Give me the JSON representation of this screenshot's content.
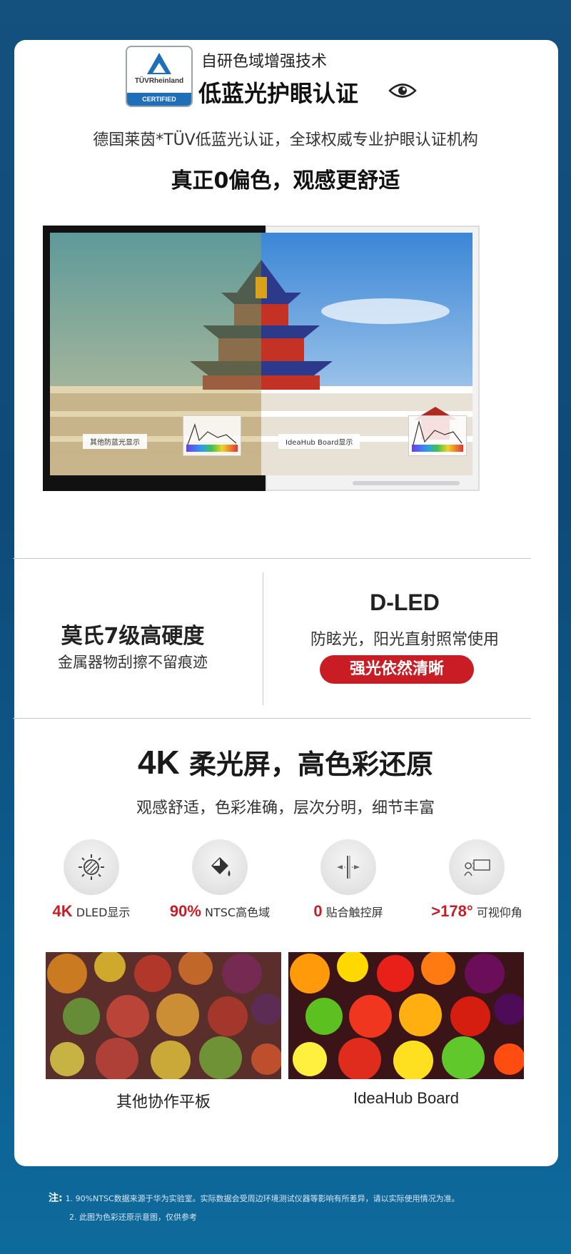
{
  "header": {
    "logo_brand": "TÜVRheinland",
    "logo_certified": "CERTIFIED",
    "subtitle": "自研色域增强技术",
    "title": "低蓝光护眼认证",
    "description": "德国莱茵*TÜV低蓝光认证，全球权威专业护眼认证机构",
    "headline": "真正0偏色，观感更舒适"
  },
  "comparison": {
    "left_label": "其他防蓝光显示",
    "right_label": "IdeaHub Board显示"
  },
  "hardness": {
    "title": "莫氏7级高硬度",
    "subtitle": "金属器物刮擦不留痕迹"
  },
  "dled": {
    "title": "D-LED",
    "subtitle": "防眩光，阳光直射照常使用",
    "badge": "强光依然清晰"
  },
  "display": {
    "title_k": "4K",
    "title_rest": " 柔光屏，高色彩还原",
    "subtitle": "观感舒适，色彩准确，层次分明，细节丰富"
  },
  "features": [
    {
      "value": "4K",
      "label": "DLED显示",
      "icon": "sun-icon"
    },
    {
      "value": "90%",
      "label": "NTSC高色域",
      "icon": "paint-bucket-icon"
    },
    {
      "value": "0",
      "label": "贴合触控屏",
      "icon": "touch-layer-icon"
    },
    {
      "value": ">178°",
      "label": "可视仰角",
      "icon": "viewing-angle-icon"
    }
  ],
  "fruit_compare": {
    "left_caption": "其他协作平板",
    "right_caption": "IdeaHub Board"
  },
  "notes": {
    "prefix": "注:",
    "note1": "1. 90%NTSC数据来源于华为实验室。实际数据会受周边环境测试仪器等影响有所差异，请以实际使用情况为准。",
    "note2": "2. 此图为色彩还原示意图，仅供参考"
  },
  "colors": {
    "accent_red": "#c81d24",
    "background_blue": "#0e4a78",
    "tuv_blue": "#1f6fb8"
  }
}
